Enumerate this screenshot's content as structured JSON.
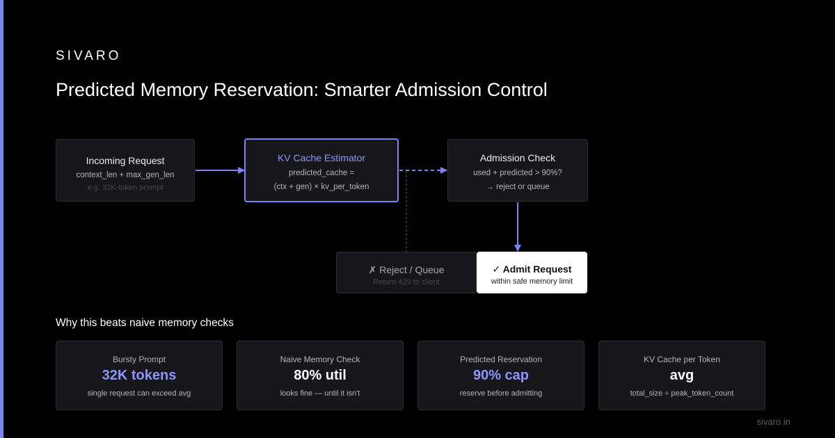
{
  "brand": "SIVARO",
  "title": "Predicted Memory Reservation: Smarter Admission Control",
  "colors": {
    "accent": "#7c84f5",
    "background": "#000000",
    "card": "#17171b",
    "border": "#2c2c33"
  },
  "flow": {
    "incoming": {
      "title": "Incoming Request",
      "line1": "context_len + max_gen_len",
      "line2": "e.g. 32K-token prompt"
    },
    "estimator": {
      "title": "KV Cache Estimator",
      "line1": "predicted_cache =",
      "line2": "(ctx + gen) × kv_per_token"
    },
    "admission": {
      "title": "Admission Check",
      "line1": "used + predicted > 90%?",
      "line2": "→ reject or queue"
    },
    "reject": {
      "title": "✗ Reject / Queue",
      "line1": "Return 429 to client"
    },
    "admit": {
      "title": "✓ Admit Request",
      "line1": "within safe memory limit"
    }
  },
  "section_title": "Why this beats naive memory checks",
  "cards": [
    {
      "label": "Bursty Prompt",
      "value": "32K tokens",
      "sub": "single request can exceed avg",
      "accent": true
    },
    {
      "label": "Naive Memory Check",
      "value": "80% util",
      "sub": "looks fine — until it isn't",
      "accent": false
    },
    {
      "label": "Predicted Reservation",
      "value": "90% cap",
      "sub": "reserve before admitting",
      "accent": true
    },
    {
      "label": "KV Cache per Token",
      "value": "avg",
      "sub": "total_size ÷ peak_token_count",
      "accent": false
    }
  ],
  "footer": "sivaro.in"
}
